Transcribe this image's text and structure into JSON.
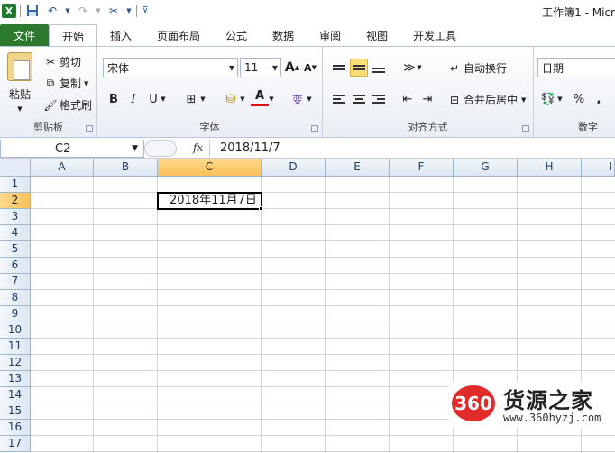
{
  "window": {
    "title": "工作簿1 - Micr"
  },
  "tabs": [
    {
      "label": "文件"
    },
    {
      "label": "开始"
    },
    {
      "label": "插入"
    },
    {
      "label": "页面布局"
    },
    {
      "label": "公式"
    },
    {
      "label": "数据"
    },
    {
      "label": "审阅"
    },
    {
      "label": "视图"
    },
    {
      "label": "开发工具"
    }
  ],
  "ribbon": {
    "clipboard": {
      "label": "剪贴板",
      "paste": "粘贴",
      "cut": "剪切",
      "copy": "复制",
      "format_painter": "格式刷"
    },
    "font": {
      "label": "字体",
      "name": "宋体",
      "size": "11",
      "bold": "B",
      "italic": "I",
      "underline": "U",
      "grow": "A",
      "shrink": "A",
      "phonetic": "wén"
    },
    "alignment": {
      "label": "对齐方式",
      "wrap_text": "自动换行",
      "merge_center": "合并后居中"
    },
    "number": {
      "label": "数字",
      "format": "日期",
      "percent": "%",
      "comma": ","
    }
  },
  "formula_bar": {
    "name_box": "C2",
    "fx": "fx",
    "value": "2018/11/7"
  },
  "grid": {
    "columns": [
      "A",
      "B",
      "C",
      "D",
      "E",
      "F",
      "G",
      "H",
      "I"
    ],
    "rows": [
      "1",
      "2",
      "3",
      "4",
      "5",
      "6",
      "7",
      "8",
      "9",
      "10",
      "11",
      "12",
      "13",
      "14",
      "15",
      "16",
      "17"
    ],
    "selected_column": "C",
    "selected_row": "2",
    "active_cell_value": "2018年11月7日"
  },
  "watermark": {
    "badge": "360",
    "title": "货源之家",
    "url": "www.360hyzj.com"
  }
}
